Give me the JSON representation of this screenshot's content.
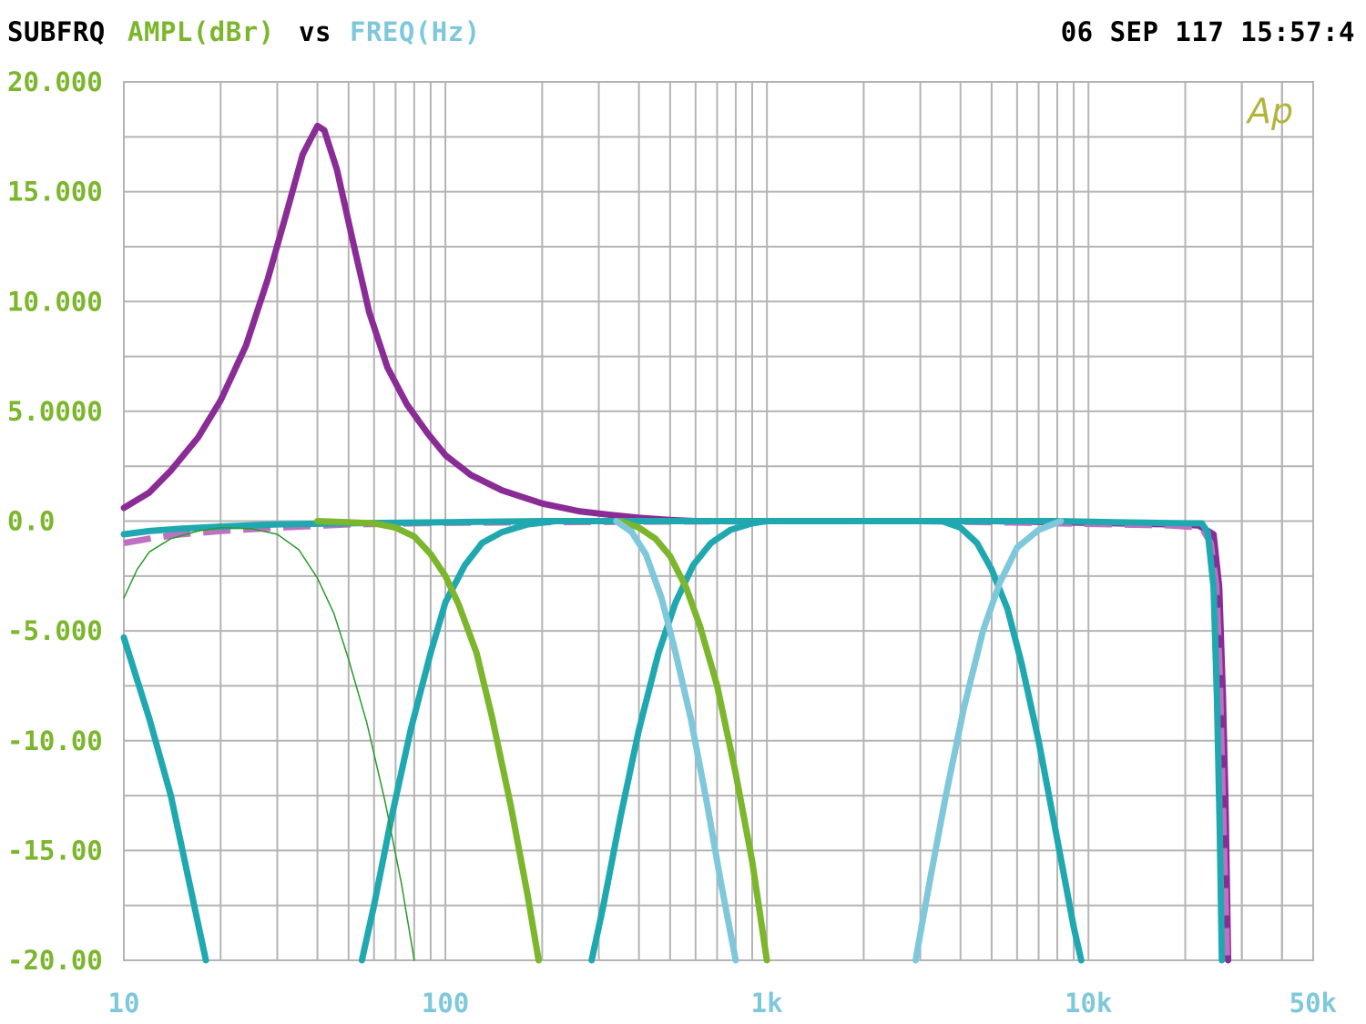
{
  "header": {
    "measurement": "SUBFRQ",
    "y_quantity": "AMPL(dBr)",
    "vs": "vs",
    "x_quantity": "FREQ(Hz)",
    "timestamp": "06 SEP 117 15:57:4"
  },
  "watermark": "Ap",
  "colors": {
    "background": "#ffffff",
    "grid": "#b4b4b4",
    "axis_text_y": "#7cb62c",
    "axis_text_x": "#7fc8dc",
    "header_text": "#000000",
    "watermark": "#b4b43c"
  },
  "chart_data": {
    "type": "line",
    "title": "",
    "xlabel": "FREQ(Hz)",
    "ylabel": "AMPL(dBr)",
    "x_scale": "log",
    "xlim": [
      10,
      50000
    ],
    "ylim": [
      -20,
      20
    ],
    "grid": true,
    "y_ticks": [
      {
        "value": 20,
        "label": "20.000"
      },
      {
        "value": 15,
        "label": "15.000"
      },
      {
        "value": 10,
        "label": "10.000"
      },
      {
        "value": 5,
        "label": "5.0000"
      },
      {
        "value": 0,
        "label": "0.0"
      },
      {
        "value": -5,
        "label": "-5.000"
      },
      {
        "value": -10,
        "label": "-10.00"
      },
      {
        "value": -15,
        "label": "-15.00"
      },
      {
        "value": -20,
        "label": "-20.00"
      }
    ],
    "x_ticks": [
      {
        "value": 10,
        "label": "10"
      },
      {
        "value": 100,
        "label": "100"
      },
      {
        "value": 1000,
        "label": "1k"
      },
      {
        "value": 10000,
        "label": "10k"
      },
      {
        "value": 50000,
        "label": "50k"
      }
    ],
    "series": [
      {
        "color": "#8a2c96",
        "width": 7,
        "dash": "",
        "points": [
          [
            10,
            0.6
          ],
          [
            12,
            1.3
          ],
          [
            14,
            2.3
          ],
          [
            17,
            3.8
          ],
          [
            20,
            5.5
          ],
          [
            24,
            8
          ],
          [
            28,
            11
          ],
          [
            32,
            14
          ],
          [
            36,
            16.7
          ],
          [
            40,
            18
          ],
          [
            42,
            17.8
          ],
          [
            46,
            16
          ],
          [
            52,
            12.5
          ],
          [
            58,
            9.5
          ],
          [
            66,
            7
          ],
          [
            76,
            5.3
          ],
          [
            88,
            4
          ],
          [
            100,
            3
          ],
          [
            120,
            2.1
          ],
          [
            150,
            1.4
          ],
          [
            200,
            0.8
          ],
          [
            260,
            0.45
          ],
          [
            320,
            0.3
          ],
          [
            400,
            0.15
          ],
          [
            500,
            0.05
          ],
          [
            600,
            0
          ],
          [
            800,
            0
          ],
          [
            1000,
            0
          ],
          [
            1500,
            0
          ],
          [
            3000,
            0
          ],
          [
            5000,
            0
          ],
          [
            8000,
            -0.05
          ],
          [
            12000,
            -0.1
          ],
          [
            18000,
            -0.15
          ],
          [
            22000,
            -0.2
          ],
          [
            24500,
            -0.6
          ],
          [
            25500,
            -3
          ],
          [
            26200,
            -8
          ],
          [
            26700,
            -13
          ],
          [
            27200,
            -20
          ]
        ]
      },
      {
        "color": "#c070c0",
        "width": 7,
        "dash": "30 14",
        "points": [
          [
            10,
            -1
          ],
          [
            12,
            -0.8
          ],
          [
            15,
            -0.6
          ],
          [
            20,
            -0.45
          ],
          [
            30,
            -0.3
          ],
          [
            50,
            -0.15
          ],
          [
            100,
            -0.08
          ],
          [
            200,
            -0.05
          ],
          [
            500,
            -0.02
          ],
          [
            1000,
            0
          ],
          [
            3000,
            0
          ],
          [
            5000,
            -0.05
          ],
          [
            8000,
            -0.1
          ],
          [
            12000,
            -0.15
          ],
          [
            18000,
            -0.2
          ],
          [
            22500,
            -0.3
          ],
          [
            24000,
            -1
          ],
          [
            25000,
            -3
          ],
          [
            25600,
            -7
          ],
          [
            26200,
            -13
          ],
          [
            27000,
            -20
          ]
        ]
      },
      {
        "color": "#20a8b0",
        "width": 7,
        "dash": "",
        "points": [
          [
            10,
            -0.6
          ],
          [
            12,
            -0.45
          ],
          [
            15,
            -0.35
          ],
          [
            20,
            -0.25
          ],
          [
            30,
            -0.15
          ],
          [
            50,
            -0.1
          ],
          [
            100,
            -0.05
          ],
          [
            200,
            0
          ],
          [
            500,
            0
          ],
          [
            1000,
            0
          ],
          [
            3000,
            0
          ],
          [
            8000,
            0
          ],
          [
            12000,
            -0.05
          ],
          [
            16000,
            -0.08
          ],
          [
            20000,
            -0.1
          ],
          [
            22500,
            -0.1
          ],
          [
            23500,
            -0.5
          ],
          [
            24500,
            -3
          ],
          [
            25100,
            -8
          ],
          [
            25600,
            -14
          ],
          [
            26000,
            -20
          ]
        ]
      },
      {
        "color": "#20a8b0",
        "width": 7,
        "dash": "",
        "points": [
          [
            10,
            -5.3
          ],
          [
            12,
            -9
          ],
          [
            14,
            -12.5
          ],
          [
            16,
            -16.5
          ],
          [
            18,
            -20
          ]
        ]
      },
      {
        "color": "#20a8b0",
        "width": 7,
        "dash": "",
        "points": [
          [
            55,
            -20
          ],
          [
            60,
            -17.5
          ],
          [
            68,
            -13.5
          ],
          [
            78,
            -9.5
          ],
          [
            90,
            -6
          ],
          [
            100,
            -3.7
          ],
          [
            115,
            -2
          ],
          [
            130,
            -1
          ],
          [
            150,
            -0.5
          ],
          [
            180,
            -0.15
          ],
          [
            220,
            0
          ]
        ]
      },
      {
        "color": "#20a8b0",
        "width": 7,
        "dash": "",
        "points": [
          [
            285,
            -20
          ],
          [
            310,
            -17.5
          ],
          [
            350,
            -13.5
          ],
          [
            400,
            -9.5
          ],
          [
            460,
            -6
          ],
          [
            520,
            -3.7
          ],
          [
            590,
            -2
          ],
          [
            670,
            -1
          ],
          [
            770,
            -0.4
          ],
          [
            900,
            -0.1
          ],
          [
            1000,
            0
          ]
        ]
      },
      {
        "color": "#20a8b0",
        "width": 7,
        "dash": "",
        "points": [
          [
            3500,
            0
          ],
          [
            4000,
            -0.3
          ],
          [
            4500,
            -1
          ],
          [
            5000,
            -2.2
          ],
          [
            5600,
            -4
          ],
          [
            6200,
            -6.5
          ],
          [
            7000,
            -10
          ],
          [
            8000,
            -14.5
          ],
          [
            9000,
            -18.5
          ],
          [
            9500,
            -20
          ]
        ]
      },
      {
        "color": "#7cb62c",
        "width": 7,
        "dash": "",
        "points": [
          [
            40,
            0
          ],
          [
            60,
            -0.1
          ],
          [
            70,
            -0.3
          ],
          [
            80,
            -0.7
          ],
          [
            90,
            -1.5
          ],
          [
            100,
            -2.5
          ],
          [
            110,
            -3.8
          ],
          [
            125,
            -6
          ],
          [
            140,
            -9
          ],
          [
            160,
            -13
          ],
          [
            180,
            -17
          ],
          [
            195,
            -20
          ]
        ]
      },
      {
        "color": "#7cb62c",
        "width": 7,
        "dash": "",
        "points": [
          [
            350,
            0
          ],
          [
            400,
            -0.3
          ],
          [
            450,
            -0.8
          ],
          [
            500,
            -1.6
          ],
          [
            560,
            -3
          ],
          [
            620,
            -4.8
          ],
          [
            700,
            -7.5
          ],
          [
            800,
            -11.5
          ],
          [
            900,
            -15.5
          ],
          [
            1000,
            -20
          ]
        ]
      },
      {
        "color": "#2a9a2a",
        "width": 1.5,
        "dash": "",
        "points": [
          [
            10,
            -3.5
          ],
          [
            11,
            -2.2
          ],
          [
            12,
            -1.4
          ],
          [
            14,
            -0.8
          ],
          [
            17,
            -0.45
          ],
          [
            20,
            -0.3
          ],
          [
            25,
            -0.35
          ],
          [
            30,
            -0.6
          ],
          [
            35,
            -1.3
          ],
          [
            40,
            -2.6
          ],
          [
            45,
            -4.2
          ],
          [
            50,
            -6.3
          ],
          [
            57,
            -9.2
          ],
          [
            65,
            -12.8
          ],
          [
            73,
            -16.5
          ],
          [
            80,
            -20
          ]
        ]
      },
      {
        "color": "#7fc8dc",
        "width": 7,
        "dash": "",
        "points": [
          [
            340,
            0
          ],
          [
            380,
            -0.5
          ],
          [
            420,
            -1.5
          ],
          [
            470,
            -3.5
          ],
          [
            520,
            -6
          ],
          [
            580,
            -9
          ],
          [
            650,
            -12.8
          ],
          [
            720,
            -16.5
          ],
          [
            800,
            -20
          ]
        ]
      },
      {
        "color": "#7fc8dc",
        "width": 7,
        "dash": "",
        "points": [
          [
            2900,
            -20
          ],
          [
            3200,
            -16.5
          ],
          [
            3600,
            -12.5
          ],
          [
            4100,
            -8.5
          ],
          [
            4700,
            -5
          ],
          [
            5300,
            -2.8
          ],
          [
            6000,
            -1.2
          ],
          [
            7000,
            -0.4
          ],
          [
            8200,
            0
          ]
        ]
      }
    ]
  }
}
